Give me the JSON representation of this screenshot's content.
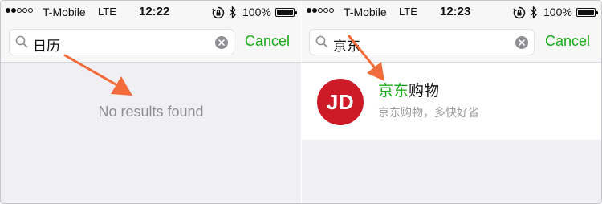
{
  "colors": {
    "accent_green": "#1aad19",
    "arrow_orange": "#f26b3a",
    "app_icon_red": "#cc1a27",
    "background_gray": "#efeff4"
  },
  "screens": [
    {
      "status_bar": {
        "carrier": "T-Mobile",
        "network": "LTE",
        "time": "12:22",
        "battery": "100%",
        "signal_bars_filled": 2,
        "signal_bars_total": 5
      },
      "search": {
        "query": "日历",
        "icon": "search-icon",
        "clear_icon": "clear-icon",
        "cancel_label": "Cancel"
      },
      "message": "No results found"
    },
    {
      "status_bar": {
        "carrier": "T-Mobile",
        "network": "LTE",
        "time": "12:23",
        "battery": "100%",
        "signal_bars_filled": 2,
        "signal_bars_total": 5
      },
      "search": {
        "query": "京东",
        "icon": "search-icon",
        "clear_icon": "clear-icon",
        "cancel_label": "Cancel"
      },
      "results": [
        {
          "icon_text": "JD",
          "title_match": "京东",
          "title_rest": "购物",
          "description": "京东购物，多快好省"
        }
      ]
    }
  ]
}
